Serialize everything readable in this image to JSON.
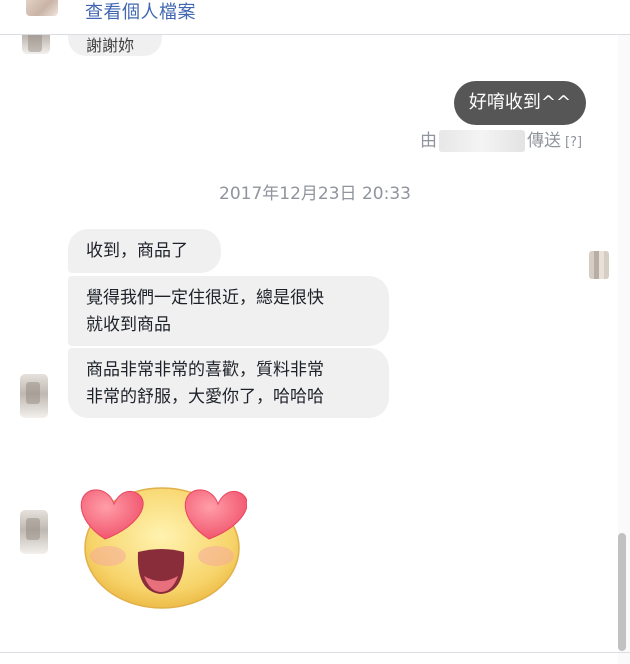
{
  "header": {
    "profile_link": "查看個人檔案"
  },
  "partial_message": {
    "text": "謝謝妳"
  },
  "sent_message": {
    "text": "好唷收到^^",
    "meta_prefix": "由",
    "meta_suffix": "傳送",
    "meta_help": "[?]"
  },
  "timestamp": "2017年12月23日 20:33",
  "received_messages": [
    {
      "text": "收到，商品了"
    },
    {
      "line1": "覺得我們一定住很近，總是很快",
      "line2": "就收到商品"
    },
    {
      "line1": "商品非常非常的喜歡，質料非常",
      "line2": "非常的舒服，大愛你了，哈哈哈"
    }
  ],
  "sticker": {
    "icon": "heart-eyes-emoji-icon"
  },
  "colors": {
    "sent_bubble": "#565656",
    "received_bubble": "#f1f0f0",
    "link": "#4267b2",
    "meta_text": "#90949c"
  }
}
